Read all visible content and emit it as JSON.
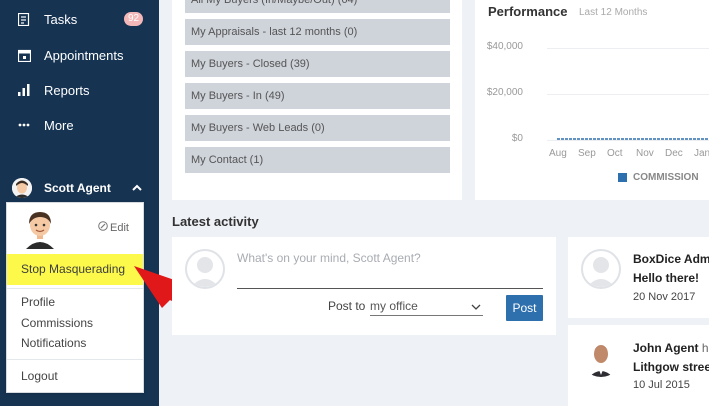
{
  "sidebar": {
    "items": [
      {
        "label": "Tasks",
        "icon": "tasks-icon",
        "badge": "92"
      },
      {
        "label": "Appointments",
        "icon": "calendar-icon"
      },
      {
        "label": "Reports",
        "icon": "bar-chart-icon"
      },
      {
        "label": "More",
        "icon": "more-icon"
      }
    ],
    "user": {
      "name": "Scott Agent"
    }
  },
  "user_menu": {
    "edit_label": "Edit",
    "stop_masquerading": "Stop Masquerading",
    "links": [
      "Profile",
      "Commissions",
      "Notifications"
    ],
    "logout": "Logout",
    "highlight_color": "#fcf94a"
  },
  "buyers_list": {
    "items": [
      "All My Buyers (In/Maybe/Out) (64)",
      "My Appraisals - last 12 months (0)",
      "My Buyers - Closed (39)",
      "My Buyers - In (49)",
      "My Buyers - Web Leads (0)",
      "My Contact (1)"
    ]
  },
  "performance": {
    "title": "Performance",
    "subtitle": "Last 12 Months"
  },
  "chart_data": {
    "type": "line",
    "categories": [
      "Aug",
      "Sep",
      "Oct",
      "Nov",
      "Dec",
      "Jan"
    ],
    "series": [
      {
        "name": "COMMISSION",
        "values": [
          0,
          0,
          0,
          0,
          0,
          0
        ],
        "color": "#2e6fae"
      }
    ],
    "yticks": [
      "$40,000",
      "$20,000",
      "$0"
    ],
    "ylim": [
      0,
      40000
    ],
    "grid": true,
    "legend": "bottom"
  },
  "activity": {
    "title": "Latest activity",
    "placeholder": "What's on your mind, Scott Agent?",
    "post_to_label": "Post to",
    "post_to_value": "my office",
    "post_button": "Post",
    "feed": [
      {
        "name": "BoxDice Adm",
        "rest": "",
        "message": "Hello there!",
        "date": "20 Nov 2017"
      },
      {
        "name": "John Agent",
        "rest": " h",
        "message": "Lithgow stree",
        "date": "10 Jul 2015"
      }
    ]
  }
}
